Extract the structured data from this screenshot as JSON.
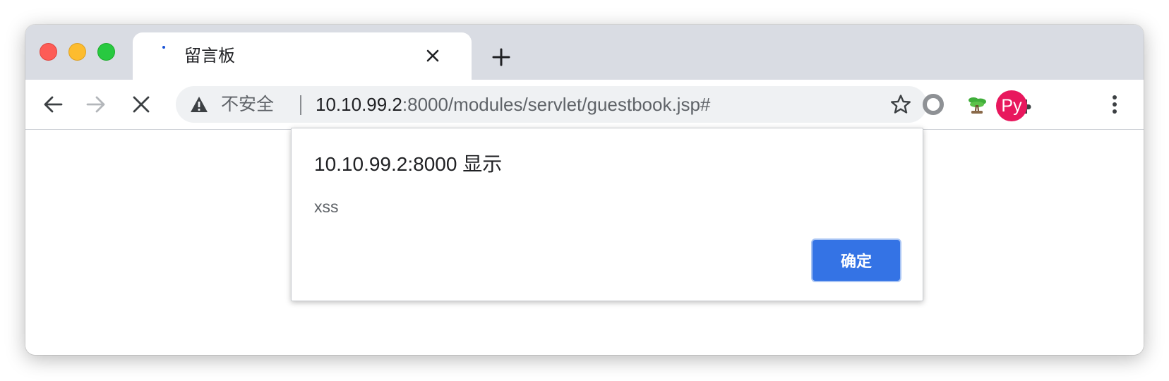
{
  "tab": {
    "title": "留言板",
    "favicon": "loading-dot-icon",
    "close_icon": "close-icon"
  },
  "toolbar": {
    "back_icon": "arrow-left-icon",
    "forward_icon": "arrow-right-icon",
    "stop_icon": "close-icon",
    "new_tab_icon": "plus-icon"
  },
  "omnibox": {
    "security_icon": "warning-triangle-icon",
    "security_label": "不安全",
    "url_host": "10.10.99.2",
    "url_rest": ":8000/modules/servlet/guestbook.jsp#",
    "bookmark_icon": "star-outline-icon"
  },
  "extensions": {
    "ring_icon": "ring-extension-icon",
    "tree_icon": "bonsai-extension-icon",
    "puzzle_icon": "puzzle-icon",
    "menu_icon": "vertical-dots-icon"
  },
  "profile": {
    "initials": "Py",
    "color": "#e8175d"
  },
  "dialog": {
    "title": "10.10.99.2:8000 显示",
    "message": "xss",
    "ok_label": "确定",
    "ok_color": "#3473e5"
  }
}
